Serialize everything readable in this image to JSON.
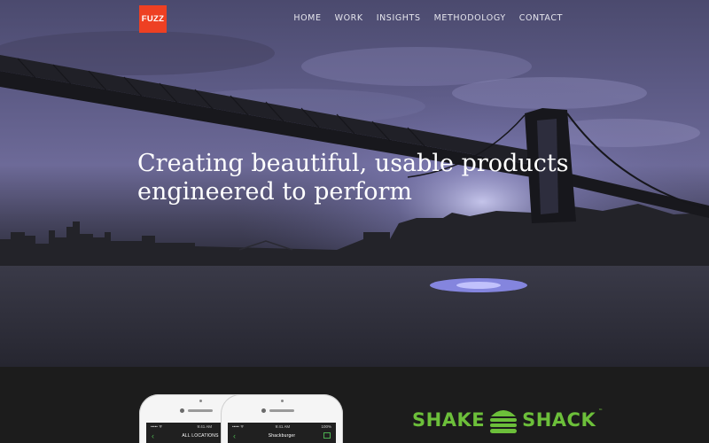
{
  "brand": {
    "logo_text": "FUZZ",
    "color": "#ee4023"
  },
  "nav": {
    "items": [
      "HOME",
      "WORK",
      "INSIGHTS",
      "METHODOLOGY",
      "CONTACT"
    ]
  },
  "hero": {
    "headline_line1": "Creating beautiful, usable products",
    "headline_line2": "engineered to perform"
  },
  "showcase": {
    "phone_left": {
      "time": "9:41 AM",
      "title": "ALL LOCATIONS"
    },
    "phone_right": {
      "time": "9:41 AM",
      "battery": "100%",
      "title": "Shackburger"
    },
    "client_logo": {
      "word1": "SHAKE",
      "word2": "SHACK",
      "mark": "™",
      "color": "#6cbf3a"
    }
  }
}
